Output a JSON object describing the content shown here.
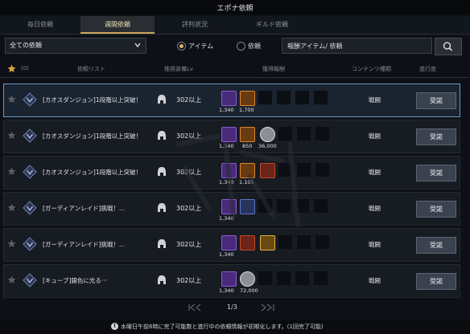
{
  "window": {
    "title": "エポナ依頼"
  },
  "tabs": [
    {
      "label": "毎日依頼",
      "active": false
    },
    {
      "label": "週間依頼",
      "active": true
    },
    {
      "label": "評判状況",
      "active": false
    },
    {
      "label": "ギルド依頼",
      "active": false
    }
  ],
  "filter": {
    "dropdown_value": "全ての依頼",
    "radio_item_label": "アイテム",
    "radio_quest_label": "依頼",
    "selected_radio": "アイテム",
    "search_placeholder": "報酬アイテム/ 依頼"
  },
  "header": {
    "favorite_count": "(0)",
    "quest_list": "依頼リスト",
    "recommended_lv": "推奨装備Lv",
    "rewards": "獲得報酬",
    "content_type": "コンテンツ種類",
    "progress": "進行度"
  },
  "rows": [
    {
      "name": "[カオスダンジョン]1段階以上突破！",
      "level": "302以上",
      "rewards": [
        {
          "icon": "purple-crystal-icon",
          "qty": "1,340"
        },
        {
          "icon": "orange-potion-icon",
          "qty": "1,700"
        }
      ],
      "content_type": "戦闘",
      "button": "受諾",
      "selected": true
    },
    {
      "name": "[カオスダンジョン]1段階以上突破！",
      "level": "302以上",
      "rewards": [
        {
          "icon": "purple-crystal-icon",
          "qty": "1,340"
        },
        {
          "icon": "orange-potion-icon",
          "qty": "850"
        },
        {
          "icon": "silver-coin-icon",
          "qty": "36,000"
        }
      ],
      "content_type": "戦闘",
      "button": "受諾",
      "selected": false
    },
    {
      "name": "[カオスダンジョン]1段階以上突破！",
      "level": "302以上",
      "rewards": [
        {
          "icon": "purple-crystal-icon",
          "qty": "1,340"
        },
        {
          "icon": "orange-potion-icon",
          "qty": "1,105"
        },
        {
          "icon": "red-chest-icon",
          "qty": ""
        }
      ],
      "content_type": "戦闘",
      "button": "受諾",
      "selected": false
    },
    {
      "name": "[ガーディアンレイド]挑戦！...",
      "level": "302以上",
      "rewards": [
        {
          "icon": "purple-crystal-icon",
          "qty": "1,340"
        },
        {
          "icon": "blue-chest-icon",
          "qty": ""
        }
      ],
      "content_type": "戦闘",
      "button": "受諾",
      "selected": false
    },
    {
      "name": "[ガーディアンレイド]挑戦！...",
      "level": "302以上",
      "rewards": [
        {
          "icon": "purple-crystal-icon",
          "qty": "1,340"
        },
        {
          "icon": "red-chest-icon",
          "qty": ""
        },
        {
          "icon": "gold-orb-icon",
          "qty": ""
        }
      ],
      "content_type": "戦闘",
      "button": "受諾",
      "selected": false
    },
    {
      "name": "[キューブ]銀色に光る···",
      "level": "302以上",
      "rewards": [
        {
          "icon": "purple-crystal-icon",
          "qty": "1,340"
        },
        {
          "icon": "silver-coin-icon",
          "qty": "72,000"
        }
      ],
      "content_type": "戦闘",
      "button": "受諾",
      "selected": false
    }
  ],
  "pagination": {
    "current": "1/3"
  },
  "footer": {
    "notice": "水曜日午前6時に完了可能数と進行中の依頼情報が初期化します。(1回完了可能)"
  },
  "colors": {
    "accent": "#c9a45c",
    "selected_border": "#6f98c2",
    "button": "#3a4250"
  }
}
